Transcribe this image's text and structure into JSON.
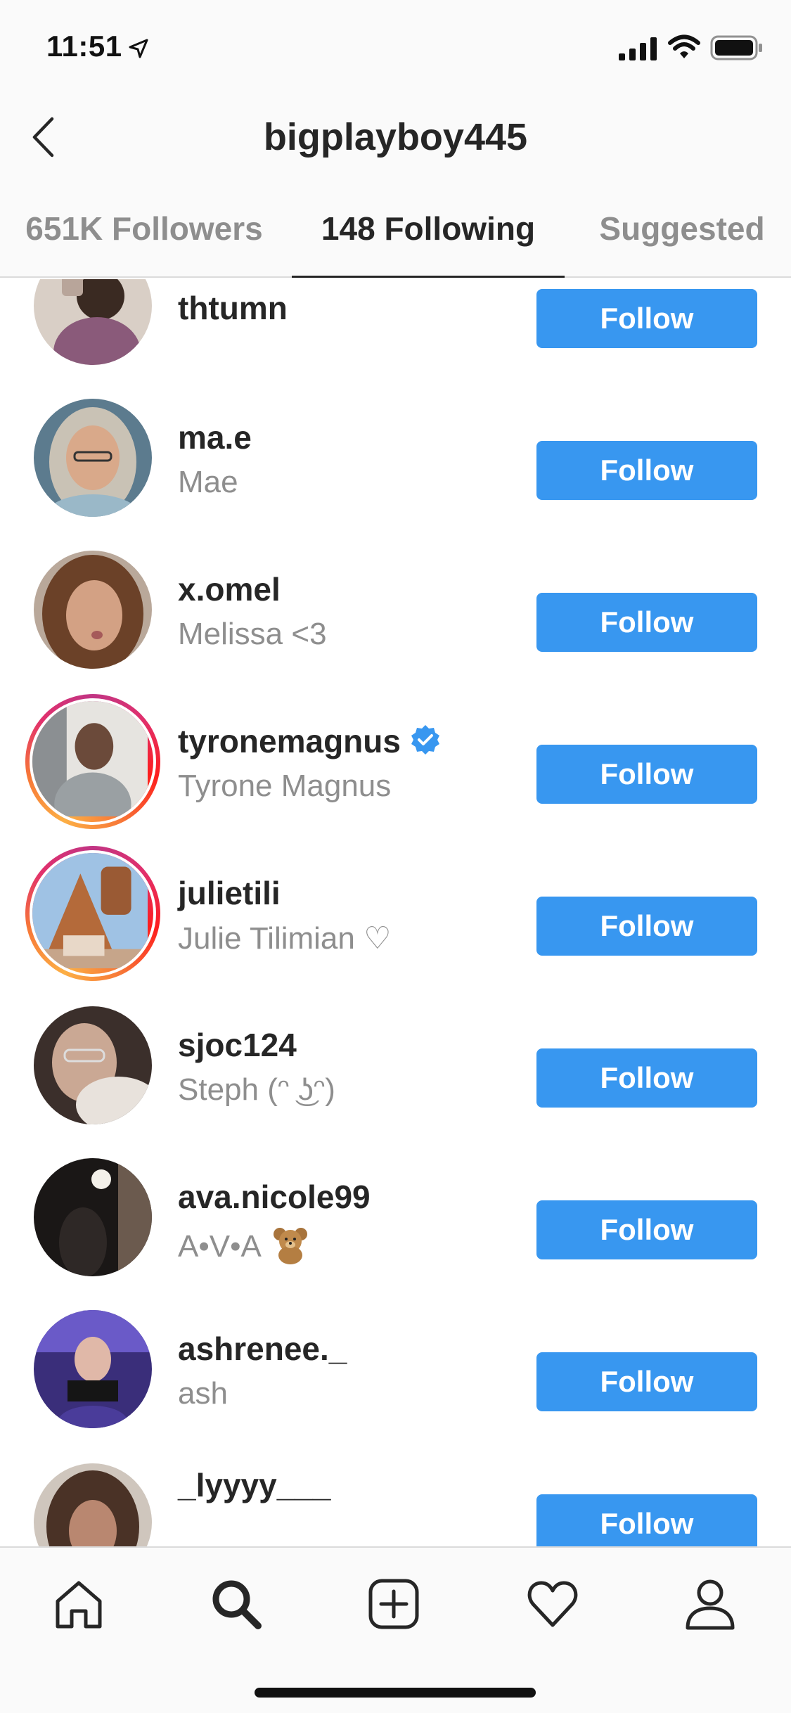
{
  "status_bar": {
    "time": "11:51"
  },
  "header": {
    "title": "bigplayboy445"
  },
  "tabs": [
    {
      "label": "651K Followers",
      "active": false
    },
    {
      "label": "148 Following",
      "active": true
    },
    {
      "label": "Suggested",
      "active": false
    }
  ],
  "colors": {
    "accent": "#3897f0",
    "verified": "#3897f0",
    "muted": "#8e8e8e",
    "text": "#262626"
  },
  "users": [
    {
      "username": "thtumn",
      "fullname": "",
      "verified": false,
      "story_ring": false,
      "button": "Follow"
    },
    {
      "username": "ma.e",
      "fullname": "Mae",
      "verified": false,
      "story_ring": false,
      "button": "Follow"
    },
    {
      "username": "x.omel",
      "fullname": "Melissa <3",
      "verified": false,
      "story_ring": false,
      "button": "Follow"
    },
    {
      "username": "tyronemagnus",
      "fullname": "Tyrone Magnus",
      "verified": true,
      "story_ring": true,
      "button": "Follow"
    },
    {
      "username": "julietili",
      "fullname": "Julie Tilimian ♡",
      "verified": false,
      "story_ring": true,
      "button": "Follow"
    },
    {
      "username": "sjoc124",
      "fullname": "Steph (ᵔ ͜ʖᵔ)",
      "verified": false,
      "story_ring": false,
      "button": "Follow"
    },
    {
      "username": "ava.nicole99",
      "fullname": "A•V•A",
      "verified": false,
      "story_ring": false,
      "button": "Follow",
      "emoji": "teddy-bear"
    },
    {
      "username": "ashrenee._",
      "fullname": "ash",
      "verified": false,
      "story_ring": false,
      "button": "Follow"
    },
    {
      "username": "_lyyyy___",
      "fullname": "",
      "verified": false,
      "story_ring": false,
      "button": "Follow"
    }
  ],
  "bottom_nav": [
    {
      "icon": "home-icon",
      "active": false
    },
    {
      "icon": "search-icon",
      "active": true
    },
    {
      "icon": "add-post-icon",
      "active": false
    },
    {
      "icon": "activity-heart-icon",
      "active": false
    },
    {
      "icon": "profile-icon",
      "active": false
    }
  ]
}
